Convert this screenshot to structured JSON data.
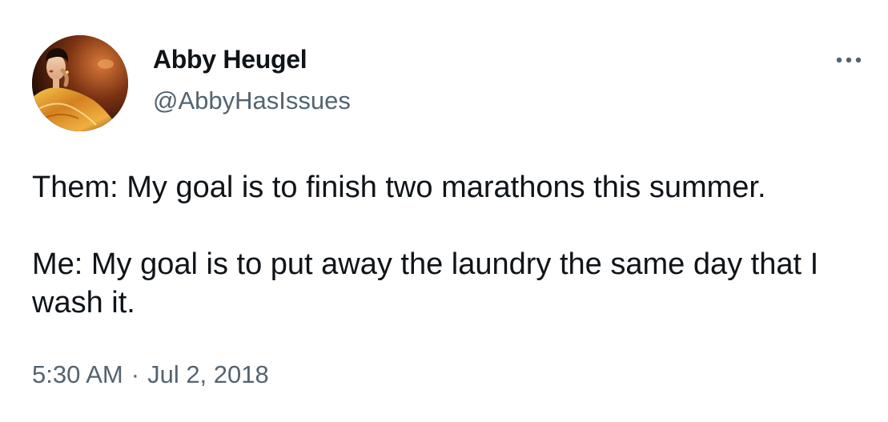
{
  "author": {
    "name": "Abby Heugel",
    "handle": "@AbbyHasIssues",
    "avatar_icon": "profile-photo"
  },
  "menu": {
    "more_icon": "more-horizontal-icon"
  },
  "tweet": {
    "lines": [
      "Them: My goal is to finish two marathons this summer.",
      "Me: My goal is to put away the laundry the same day that I wash it."
    ]
  },
  "meta": {
    "time": "5:30 AM",
    "separator": "·",
    "date": "Jul 2, 2018"
  },
  "colors": {
    "text": "#0f1419",
    "secondary": "#536471",
    "background": "#ffffff"
  }
}
